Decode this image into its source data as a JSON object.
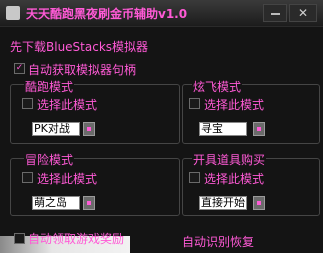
{
  "window": {
    "title": "天天酷跑黑夜刷金币辅助v1.0",
    "close_glyph": "✕",
    "check_glyph": "✓"
  },
  "notice": "先下载BlueStacks模拟器",
  "auto_get_emulator": {
    "label": "自动获取模拟器句柄",
    "checked": true
  },
  "groups": [
    {
      "title": "酷跑模式",
      "option": "选择此模式",
      "value": "PK对战"
    },
    {
      "title": "炫飞模式",
      "option": "选择此模式",
      "value": "寻宝"
    },
    {
      "title": "冒险模式",
      "option": "选择此模式",
      "value": "萌之岛"
    },
    {
      "title": "开具道具购买",
      "option": "选择此模式",
      "value": "直接开始"
    }
  ],
  "bottom": {
    "auto_reward": "自动领取游戏奖励",
    "auto_recover": "自动识别恢复"
  },
  "colors": {
    "accent": "#ff5ad6",
    "background": "#141414"
  }
}
